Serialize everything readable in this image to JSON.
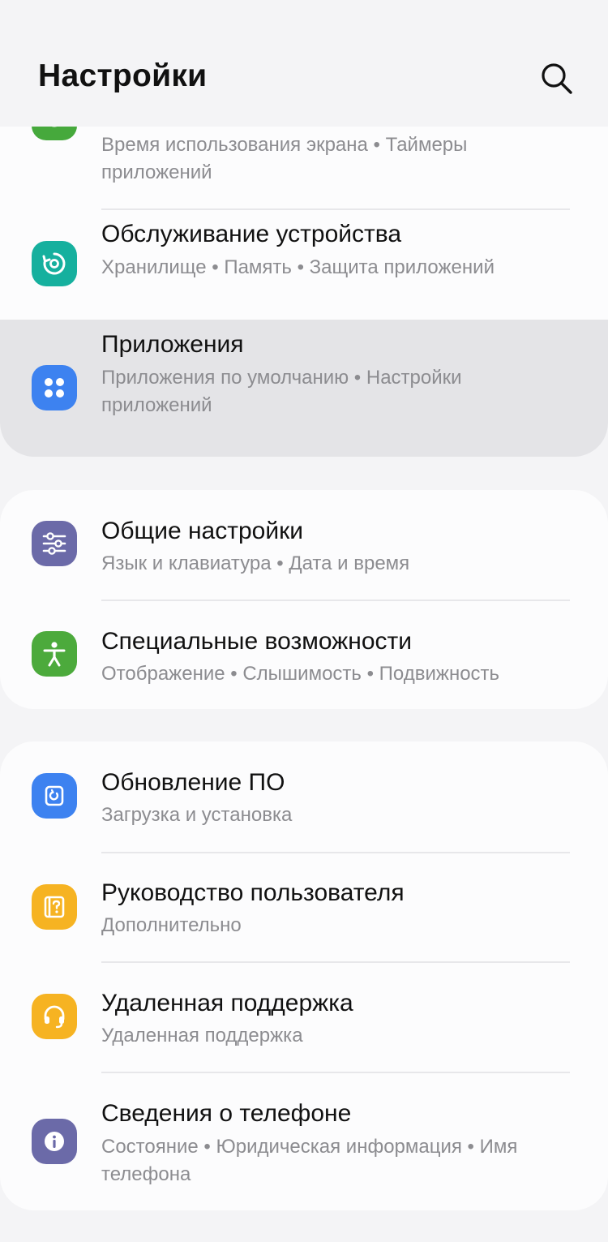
{
  "header": {
    "title": "Настройки",
    "search_icon": "search-icon"
  },
  "colors": {
    "wellbeing": "#46a93c",
    "maintenance": "#16b09e",
    "apps": "#3d82f0",
    "general": "#6b6aa8",
    "accessibility": "#4caa3c",
    "update": "#3d82f0",
    "manual": "#f6b322",
    "support": "#f6b322",
    "about": "#6b6aa8"
  },
  "groups": [
    {
      "items": [
        {
          "label": "",
          "sub": "Время использования экрана  •  Таймеры приложений",
          "icon": "digital-wellbeing-icon"
        },
        {
          "label": "Обслуживание устройства",
          "sub": "Хранилище  •  Память  •  Защита приложений",
          "icon": "device-care-icon"
        },
        {
          "label": "Приложения",
          "sub": "Приложения по умолчанию  •  Настройки приложений",
          "icon": "apps-icon"
        }
      ]
    },
    {
      "items": [
        {
          "label": "Общие настройки",
          "sub": "Язык и клавиатура  •  Дата и время",
          "icon": "sliders-icon"
        },
        {
          "label": "Специальные возможности",
          "sub": "Отображение  •  Слышимость  •  Подвижность",
          "icon": "accessibility-icon"
        }
      ]
    },
    {
      "items": [
        {
          "label": "Обновление ПО",
          "sub": "Загрузка и установка",
          "icon": "software-update-icon"
        },
        {
          "label": "Руководство пользователя",
          "sub": "Дополнительно",
          "icon": "user-manual-icon"
        },
        {
          "label": "Удаленная поддержка",
          "sub": "Удаленная поддержка",
          "icon": "headset-icon"
        },
        {
          "label": "Сведения о телефоне",
          "sub": "Состояние  •  Юридическая информация  •  Имя телефона",
          "icon": "info-icon"
        }
      ]
    }
  ]
}
